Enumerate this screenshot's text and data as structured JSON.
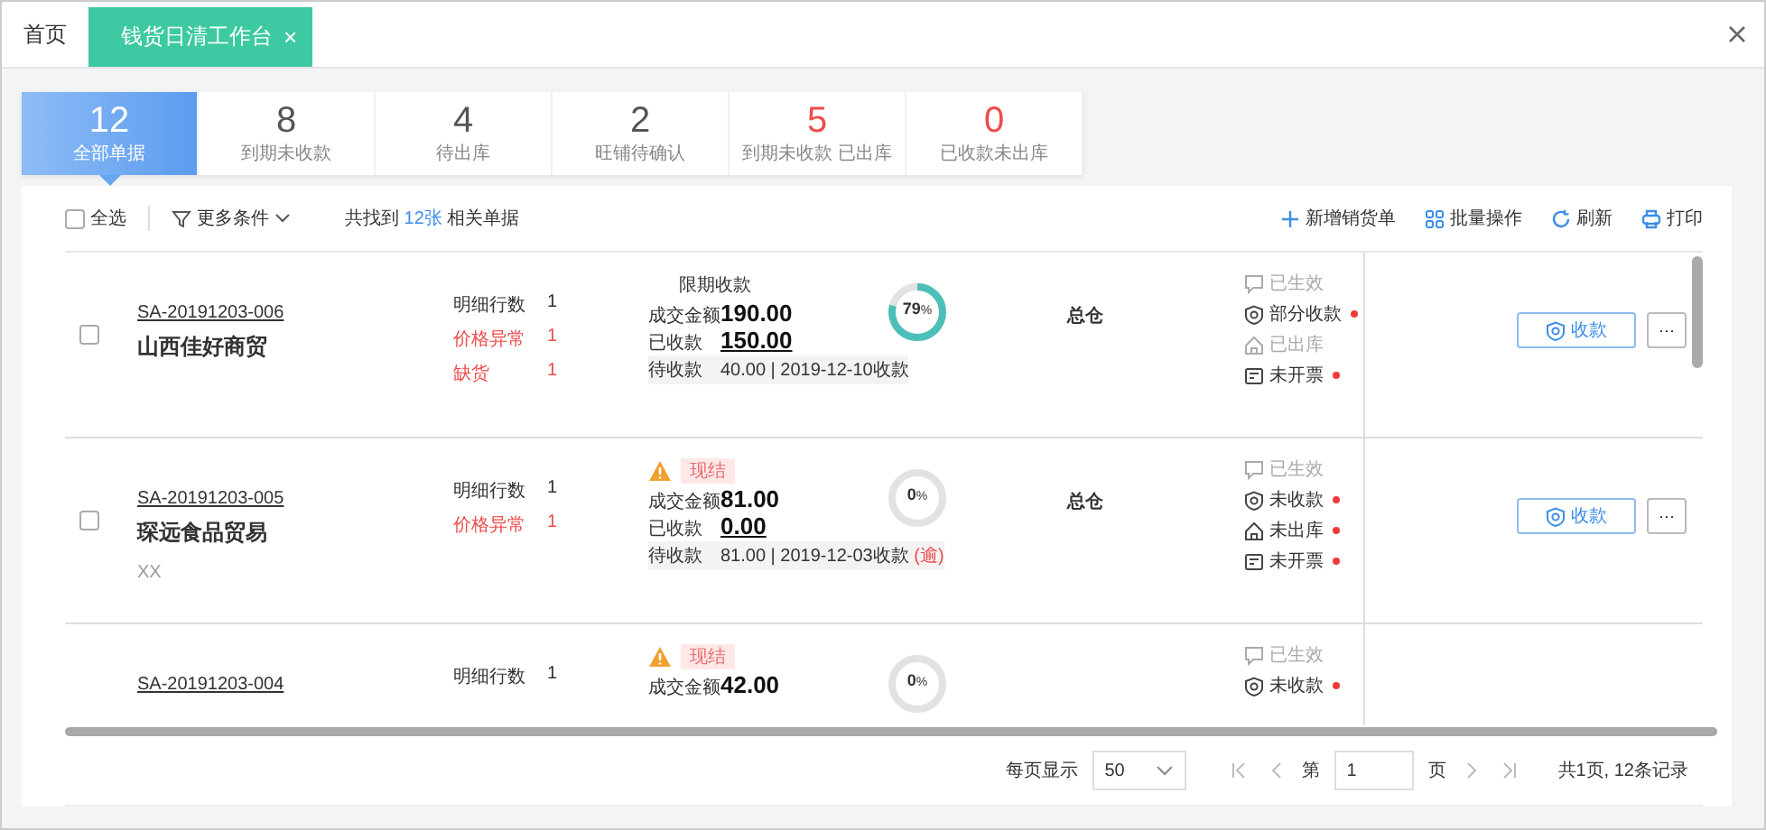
{
  "tabs": [
    {
      "label": "首页",
      "selected": false
    },
    {
      "label": "钱货日清工作台",
      "selected": true,
      "close": "×"
    }
  ],
  "stats": [
    {
      "value": "12",
      "label": "全部单据",
      "selected": true,
      "alert": false
    },
    {
      "value": "8",
      "label": "到期未收款",
      "selected": false,
      "alert": false
    },
    {
      "value": "4",
      "label": "待出库",
      "selected": false,
      "alert": false
    },
    {
      "value": "2",
      "label": "旺铺待确认",
      "selected": false,
      "alert": false
    },
    {
      "value": "5",
      "label": "到期未收款 已出库",
      "selected": false,
      "alert": true
    },
    {
      "value": "0",
      "label": "已收款未出库",
      "selected": false,
      "alert": true
    }
  ],
  "toolbar": {
    "select_all": {
      "label": "全选",
      "checked": false
    },
    "filter": "更多条件",
    "found_prefix": "共找到",
    "found_count": "12张",
    "found_suffix": "相关单据",
    "actions": [
      {
        "kind": "add",
        "label": "新增销货单"
      },
      {
        "kind": "batch",
        "label": "批量操作"
      },
      {
        "kind": "refresh",
        "label": "刷新"
      },
      {
        "kind": "print",
        "label": "打印"
      }
    ]
  },
  "rows": [
    {
      "checked": false,
      "code": "SA-20191203-006",
      "customer": "山西佳好商贸",
      "details": [
        {
          "label": "明细行数",
          "value": "1",
          "warn": false
        },
        {
          "label": "价格异常",
          "value": "1",
          "warn": true
        },
        {
          "label": "缺货",
          "value": "1",
          "warn": true
        }
      ],
      "term": {
        "kind": "plain",
        "label": "限期收款"
      },
      "amount_label": "成交金额",
      "amount": "190.00",
      "received_label": "已收款",
      "received": "150.00",
      "pending_label": "待收款",
      "pending": "40.00 | 2019-12-10收款",
      "progress": {
        "level": 0.79,
        "value": "79",
        "unit": "%"
      },
      "warehouse": "总仓",
      "statuses": [
        {
          "kind": "effective",
          "label": "已生效",
          "pending": false
        },
        {
          "kind": "payment",
          "label": "部分收款",
          "pending": true
        },
        {
          "kind": "outbound",
          "label": "已出库",
          "pending": false
        },
        {
          "kind": "invoice",
          "label": "未开票",
          "pending": true
        }
      ],
      "action": "收款",
      "more": "···"
    },
    {
      "checked": false,
      "code": "SA-20191203-005",
      "customer": "琛远食品贸易",
      "note": "XX",
      "details": [
        {
          "label": "明细行数",
          "value": "1",
          "warn": false
        },
        {
          "label": "价格异常",
          "value": "1",
          "warn": true
        }
      ],
      "term": {
        "kind": "warning",
        "label": "现结"
      },
      "amount_label": "成交金额",
      "amount": "81.00",
      "received_label": "已收款",
      "received": "0.00",
      "pending_label": "待收款",
      "pending": "81.00 | 2019-12-03收款",
      "overdue": "(逾)",
      "progress": {
        "level": 0,
        "value": "0",
        "unit": "%"
      },
      "warehouse": "总仓",
      "statuses": [
        {
          "kind": "effective",
          "label": "已生效",
          "pending": false
        },
        {
          "kind": "payment",
          "label": "未收款",
          "pending": true
        },
        {
          "kind": "outbound",
          "label": "未出库",
          "pending": true
        },
        {
          "kind": "invoice",
          "label": "未开票",
          "pending": true
        }
      ],
      "action": "收款",
      "more": "···"
    },
    {
      "code": "SA-20191203-004",
      "details": [
        {
          "label": "明细行数",
          "value": "1",
          "warn": false
        }
      ],
      "term": {
        "kind": "warning",
        "label": "现结"
      },
      "amount_label": "成交金额",
      "amount": "42.00",
      "progress": {
        "level": 0,
        "value": "0",
        "unit": "%"
      },
      "statuses": [
        {
          "kind": "effective",
          "label": "已生效",
          "pending": false
        },
        {
          "kind": "payment",
          "label": "未收款",
          "pending": true
        }
      ]
    }
  ],
  "pagination": {
    "page_size_label": "每页显示",
    "page_size": "50",
    "page_prefix": "第",
    "page": "1",
    "page_suffix": "页",
    "summary": "共1页, 12条记录"
  }
}
